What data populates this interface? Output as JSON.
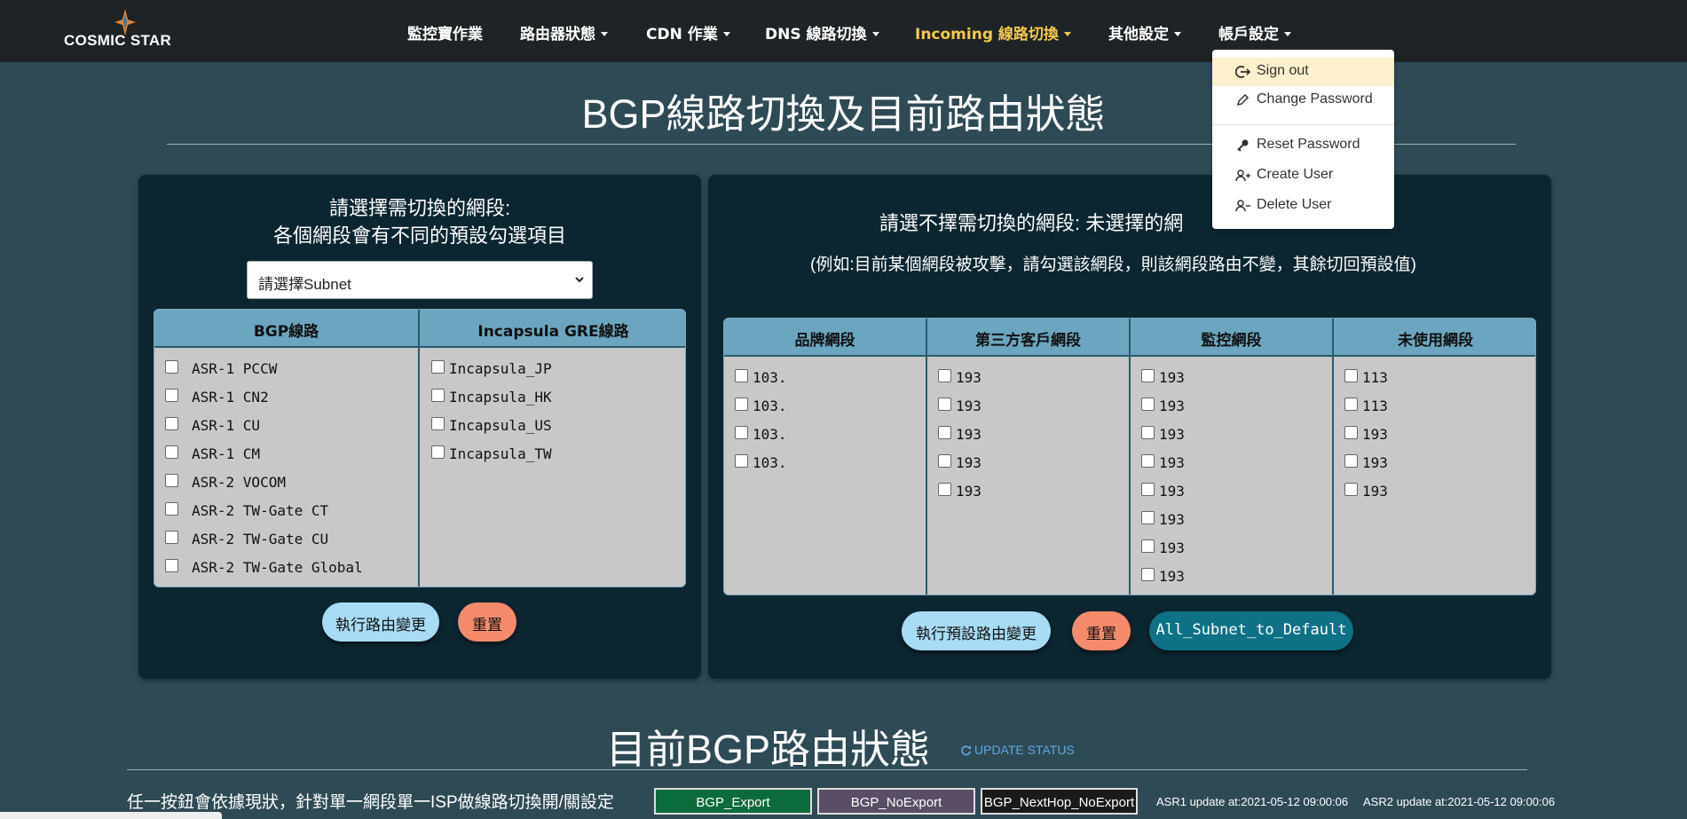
{
  "brand": {
    "logo_text": "COSMIC STAR"
  },
  "nav": {
    "items": [
      {
        "label": "監控寶作業"
      },
      {
        "label": "路由器狀態"
      },
      {
        "label": "CDN 作業"
      },
      {
        "label": "DNS 線路切換"
      },
      {
        "label": "Incoming 線路切換"
      },
      {
        "label": "其他設定"
      },
      {
        "label": "帳戶設定"
      }
    ],
    "active_color": "#f5c84c"
  },
  "account_menu": {
    "items": [
      {
        "label": "Sign out",
        "icon": "sign-out-icon"
      },
      {
        "label": "Change Password",
        "icon": "pencil-icon"
      },
      {
        "label": "Reset Password",
        "icon": "key-icon"
      },
      {
        "label": "Create User",
        "icon": "user-plus-icon"
      },
      {
        "label": "Delete User",
        "icon": "user-minus-icon"
      }
    ]
  },
  "page": {
    "title": "BGP線路切換及目前路由狀態"
  },
  "left_panel": {
    "heading1": "請選擇需切換的網段:",
    "heading2": "各個網段會有不同的預設勾選項目",
    "select_value": "請選擇Subnet",
    "col1_header": "BGP線路",
    "col2_header": "Incapsula GRE線路",
    "bgp_routes": [
      "ASR-1 PCCW",
      "ASR-1 CN2",
      "ASR-1 CU",
      "ASR-1 CM",
      "ASR-2 VOCOM",
      "ASR-2 TW-Gate CT",
      "ASR-2 TW-Gate CU",
      "ASR-2 TW-Gate Global"
    ],
    "gre_routes": [
      "Incapsula_JP",
      "Incapsula_HK",
      "Incapsula_US",
      "Incapsula_TW"
    ],
    "execute_label": "執行路由變更",
    "reset_label": "重置"
  },
  "right_panel": {
    "heading": "請選不擇需切換的網段: 未選擇的網",
    "note": "(例如:目前某個網段被攻擊，請勾選該網段，則該網段路由不變，其餘切回預設值)",
    "columns": [
      {
        "header": "品牌網段",
        "items": [
          "103.",
          "103.",
          "103.",
          "103."
        ]
      },
      {
        "header": "第三方客戶網段",
        "items": [
          "193",
          "193",
          "193",
          "193",
          "193"
        ]
      },
      {
        "header": "監控網段",
        "items": [
          "193",
          "193",
          "193",
          "193",
          "193",
          "193",
          "193",
          "193"
        ]
      },
      {
        "header": "未使用網段",
        "items": [
          "113",
          "113",
          "193",
          "193",
          "193"
        ]
      }
    ],
    "execute_label": "執行預設路由變更",
    "reset_label": "重置",
    "all_default_label": "All_Subnet_to_Default"
  },
  "status": {
    "title": "目前BGP路由狀態",
    "update_label": "UPDATE STATUS",
    "description": "任一按鈕會依據現狀，針對單一網段單一ISP做線路切換開/關設定",
    "buttons": [
      "BGP_Export",
      "BGP_NoExport",
      "BGP_NextHop_NoExport"
    ],
    "asr1_update": "ASR1 update at:2021-05-12 09:00:06",
    "asr2_update": "ASR2 update at:2021-05-12 09:00:06"
  },
  "colors": {
    "page_bg": "#2e4a55",
    "panel_bg": "#0c2631",
    "header_blue": "#6ca5bf",
    "export_green": "#0b6b3a",
    "noexport_purple": "#5a4e66"
  }
}
